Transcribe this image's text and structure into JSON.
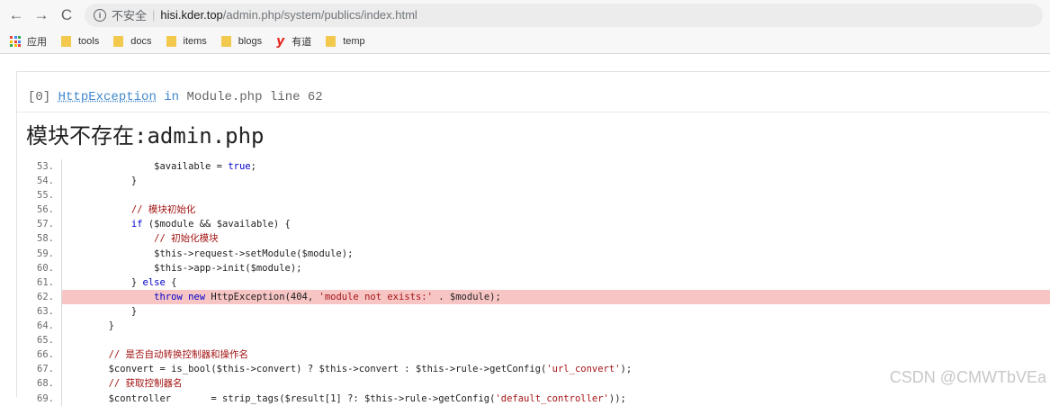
{
  "browser": {
    "back_icon": "←",
    "forward_icon": "→",
    "reload_icon": "C",
    "insecure_label": "不安全",
    "url_host": "hisi.kder.top",
    "url_path": "/admin.php/system/publics/index.html"
  },
  "bookmarks": [
    {
      "label": "应用",
      "icon": "apps-icon"
    },
    {
      "label": "tools",
      "icon": "folder-icon"
    },
    {
      "label": "docs",
      "icon": "folder-icon"
    },
    {
      "label": "items",
      "icon": "folder-icon"
    },
    {
      "label": "blogs",
      "icon": "folder-icon"
    },
    {
      "label": "有道",
      "icon": "youdao-icon"
    },
    {
      "label": "temp",
      "icon": "folder-icon"
    }
  ],
  "exception": {
    "index": "[0]",
    "class": "HttpException",
    "in_word": "in",
    "file": "Module.php",
    "line_word": "line",
    "line_no": "62",
    "message_prefix": "模块不存在",
    "message_code": ":admin.php"
  },
  "code_lines": [
    {
      "no": "53.",
      "text": "                $available = true;"
    },
    {
      "no": "54.",
      "text": "            }"
    },
    {
      "no": "55.",
      "text": ""
    },
    {
      "no": "56.",
      "text": "            // 模块初始化"
    },
    {
      "no": "57.",
      "text": "            if ($module && $available) {"
    },
    {
      "no": "58.",
      "text": "                // 初始化模块"
    },
    {
      "no": "59.",
      "text": "                $this->request->setModule($module);"
    },
    {
      "no": "60.",
      "text": "                $this->app->init($module);"
    },
    {
      "no": "61.",
      "text": "            } else {"
    },
    {
      "no": "62.",
      "text": "                throw new HttpException(404, 'module not exists:' . $module);",
      "highlight": true
    },
    {
      "no": "63.",
      "text": "            }"
    },
    {
      "no": "64.",
      "text": "        }"
    },
    {
      "no": "65.",
      "text": ""
    },
    {
      "no": "66.",
      "text": "        // 是否自动转换控制器和操作名"
    },
    {
      "no": "67.",
      "text": "        $convert = is_bool($this->convert) ? $this->convert : $this->rule->getConfig('url_convert');"
    },
    {
      "no": "68.",
      "text": "        // 获取控制器名"
    },
    {
      "no": "69.",
      "text": "        $controller       = strip_tags($result[1] ?: $this->rule->getConfig('default_controller'));"
    }
  ],
  "watermark": "CSDN @CMWTbVEa",
  "colors": {
    "highlight": "#f8c5c5",
    "keyword": "#0000cc",
    "string": "#a31515",
    "link": "#4288ce"
  }
}
